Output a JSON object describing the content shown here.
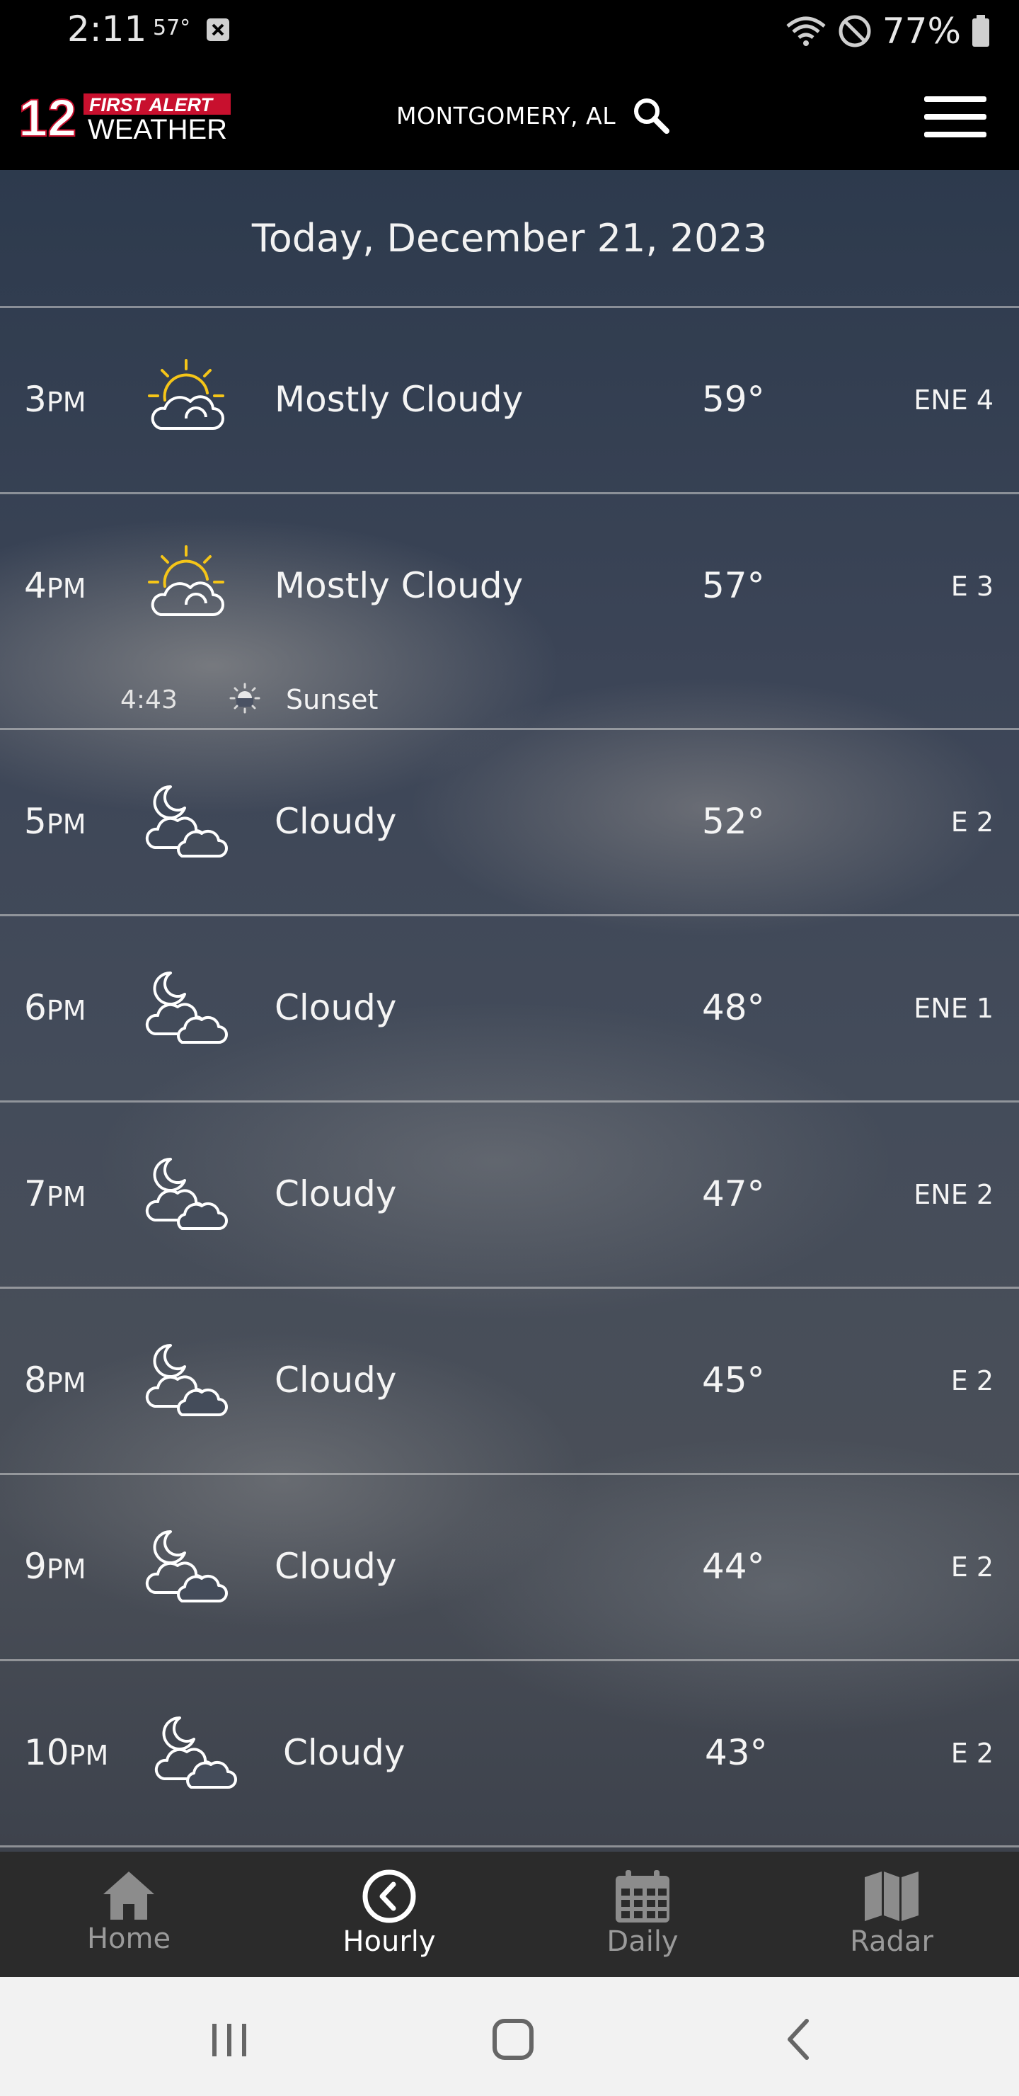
{
  "status_bar": {
    "time": "2:11",
    "temp": "57°",
    "battery": "77%"
  },
  "header": {
    "logo_text_line1": "12",
    "logo_text_line2": "FIRST ALERT",
    "logo_text_line3": "WEATHER",
    "location": "MONTGOMERY, AL"
  },
  "date_heading": "Today, December 21, 2023",
  "hours": [
    {
      "hour": "3",
      "ampm": "PM",
      "icon": "partly-cloudy-day-icon",
      "condition": "Mostly Cloudy",
      "temp": "59°",
      "wind": "ENE 4"
    },
    {
      "hour": "4",
      "ampm": "PM",
      "icon": "partly-cloudy-day-icon",
      "condition": "Mostly Cloudy",
      "temp": "57°",
      "wind": "E 3"
    },
    {
      "hour": "5",
      "ampm": "PM",
      "icon": "cloudy-night-icon",
      "condition": "Cloudy",
      "temp": "52°",
      "wind": "E 2"
    },
    {
      "hour": "6",
      "ampm": "PM",
      "icon": "cloudy-night-icon",
      "condition": "Cloudy",
      "temp": "48°",
      "wind": "ENE 1"
    },
    {
      "hour": "7",
      "ampm": "PM",
      "icon": "cloudy-night-icon",
      "condition": "Cloudy",
      "temp": "47°",
      "wind": "ENE 2"
    },
    {
      "hour": "8",
      "ampm": "PM",
      "icon": "cloudy-night-icon",
      "condition": "Cloudy",
      "temp": "45°",
      "wind": "E 2"
    },
    {
      "hour": "9",
      "ampm": "PM",
      "icon": "cloudy-night-icon",
      "condition": "Cloudy",
      "temp": "44°",
      "wind": "E 2"
    },
    {
      "hour": "10",
      "ampm": "PM",
      "icon": "cloudy-night-icon",
      "condition": "Cloudy",
      "temp": "43°",
      "wind": "E 2"
    }
  ],
  "sunset": {
    "time": "4:43",
    "label": "Sunset"
  },
  "bottom_nav": [
    {
      "label": "Home",
      "icon": "home-icon",
      "active": false
    },
    {
      "label": "Hourly",
      "icon": "clock-back-icon",
      "active": true
    },
    {
      "label": "Daily",
      "icon": "calendar-icon",
      "active": false
    },
    {
      "label": "Radar",
      "icon": "map-icon",
      "active": false
    }
  ],
  "colors": {
    "logo_red": "#c8102e",
    "sun_yellow": "#f5c518",
    "nav_bg": "#2b2b2b",
    "nav_inactive": "#9a9a9a"
  }
}
